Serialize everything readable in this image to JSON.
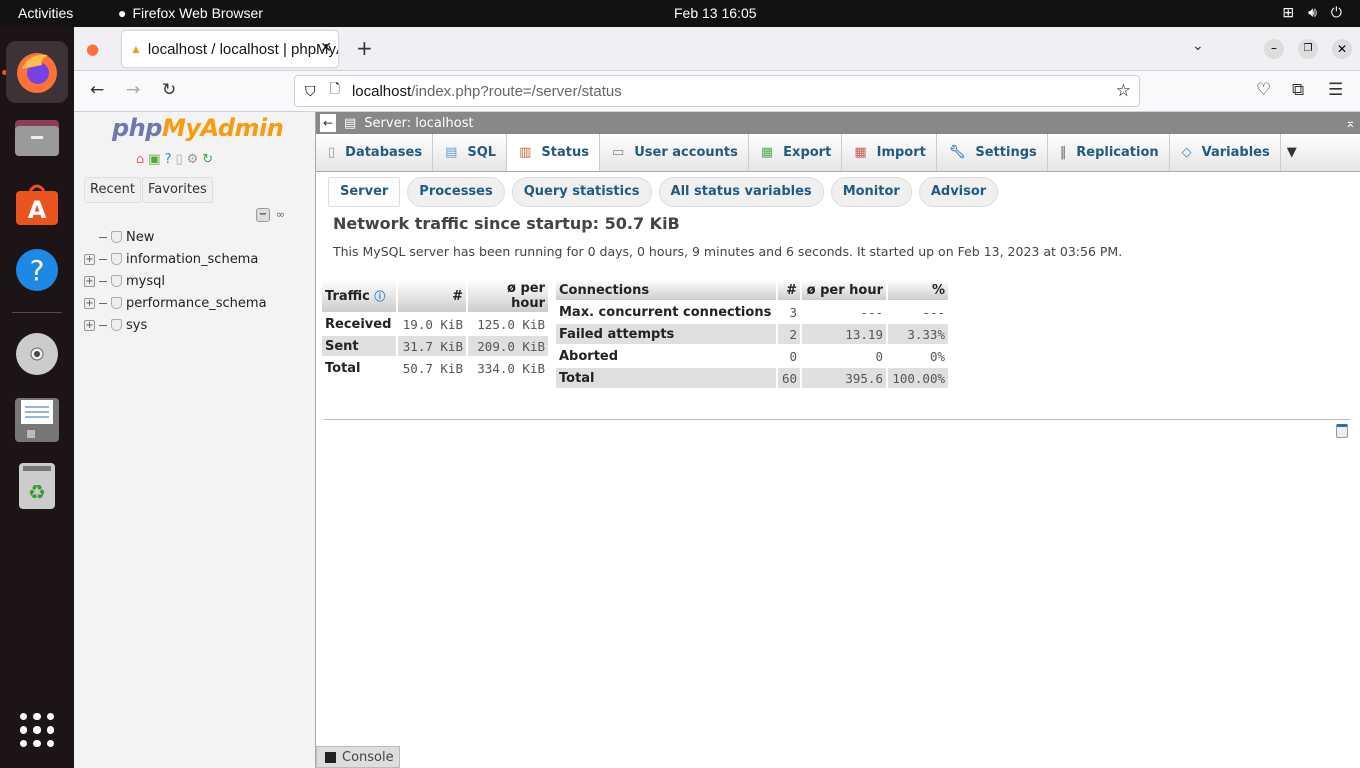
{
  "topbar": {
    "activities": "Activities",
    "app_name": "Firefox Web Browser",
    "clock": "Feb 13  16:05"
  },
  "dock": {
    "items": [
      "firefox",
      "files",
      "app-center",
      "help",
      "dvd",
      "save",
      "trash"
    ]
  },
  "browser": {
    "tab_title": "localhost / localhost | phpMyAdmin",
    "url_host": "localhost",
    "url_path": "/index.php?route=/server/status"
  },
  "pma": {
    "logo_php": "php",
    "logo_my": "MyAdmin",
    "recent": "Recent",
    "favorites": "Favorites",
    "tree": [
      {
        "name": "New"
      },
      {
        "name": "information_schema"
      },
      {
        "name": "mysql"
      },
      {
        "name": "performance_schema"
      },
      {
        "name": "sys"
      }
    ],
    "server_label": "Server: localhost",
    "menu": [
      {
        "label": "Databases"
      },
      {
        "label": "SQL"
      },
      {
        "label": "Status"
      },
      {
        "label": "User accounts"
      },
      {
        "label": "Export"
      },
      {
        "label": "Import"
      },
      {
        "label": "Settings"
      },
      {
        "label": "Replication"
      },
      {
        "label": "Variables"
      }
    ],
    "subtabs": [
      {
        "label": "Server"
      },
      {
        "label": "Processes"
      },
      {
        "label": "Query statistics"
      },
      {
        "label": "All status variables"
      },
      {
        "label": "Monitor"
      },
      {
        "label": "Advisor"
      }
    ],
    "title": "Network traffic since startup: 50.7 KiB",
    "uptime": "This MySQL server has been running for 0 days, 0 hours, 9 minutes and 6 seconds. It started up on Feb 13, 2023 at 03:56 PM.",
    "traffic": {
      "headers": [
        "Traffic",
        "#",
        "ø per hour"
      ],
      "rows": [
        {
          "label": "Received",
          "num": "19.0 KiB",
          "per_hour": "125.0 KiB"
        },
        {
          "label": "Sent",
          "num": "31.7 KiB",
          "per_hour": "209.0 KiB"
        },
        {
          "label": "Total",
          "num": "50.7 KiB",
          "per_hour": "334.0 KiB"
        }
      ]
    },
    "connections": {
      "headers": [
        "Connections",
        "#",
        "ø per hour",
        "%"
      ],
      "rows": [
        {
          "label": "Max. concurrent connections",
          "num": "3",
          "per_hour": "---",
          "pct": "---"
        },
        {
          "label": "Failed attempts",
          "num": "2",
          "per_hour": "13.19",
          "pct": "3.33%"
        },
        {
          "label": "Aborted",
          "num": "0",
          "per_hour": "0",
          "pct": "0%"
        },
        {
          "label": "Total",
          "num": "60",
          "per_hour": "395.6",
          "pct": "100.00%"
        }
      ]
    },
    "console": "Console"
  }
}
